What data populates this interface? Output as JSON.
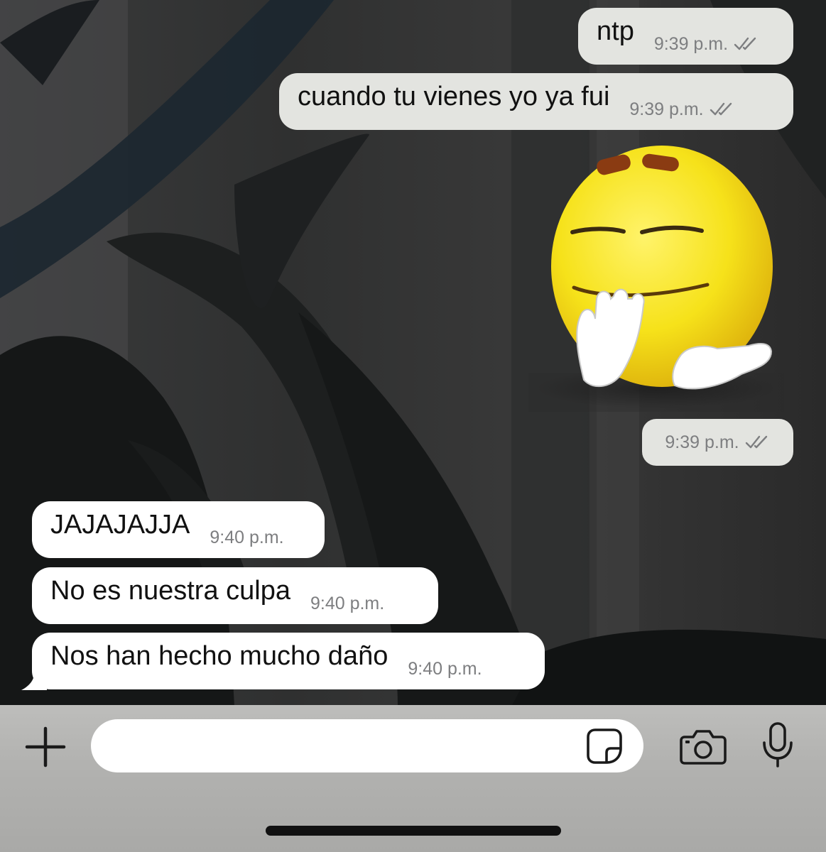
{
  "conversation": {
    "outgoing": [
      {
        "text": "ntp",
        "time": "9:39 p.m."
      },
      {
        "text": "cuando tu vienes yo ya fui",
        "time": "9:39 p.m."
      }
    ],
    "sticker": {
      "description_icon": "smirking-emoji-sticker",
      "time": "9:39 p.m."
    },
    "incoming": [
      {
        "text": "JAJAJAJJA",
        "time": "9:40 p.m."
      },
      {
        "text": "No es nuestra culpa",
        "time": "9:40 p.m."
      },
      {
        "text": "Nos han hecho mucho daño",
        "time": "9:40 p.m."
      }
    ]
  },
  "composer": {
    "value": "",
    "placeholder": ""
  },
  "icons": {
    "attach": "plus-icon",
    "sticker": "sticker-icon",
    "camera": "camera-icon",
    "mic": "microphone-icon",
    "read_receipt": "double-check-icon"
  },
  "colors": {
    "outgoing_bubble": "#e3e4e0",
    "incoming_bubble": "#ffffff",
    "meta_text": "#7d7e80",
    "input_bar": "#b5b5b3"
  }
}
